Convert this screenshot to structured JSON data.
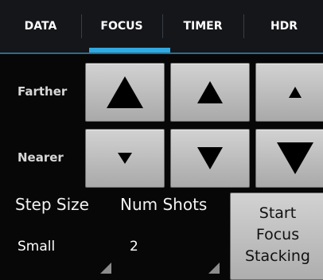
{
  "tabs": [
    {
      "label": "DATA",
      "selected": false
    },
    {
      "label": "FOCUS",
      "selected": true
    },
    {
      "label": "TIMER",
      "selected": false
    },
    {
      "label": "HDR",
      "selected": false
    }
  ],
  "colors": {
    "tab_indicator": "#31a9e0",
    "button_face": "#c4c4c4",
    "arrow": "#000000"
  },
  "focus": {
    "farther_label": "Farther",
    "nearer_label": "Nearer",
    "farther_buttons": [
      {
        "icon": "arrow-up-large-icon",
        "size": "large"
      },
      {
        "icon": "arrow-up-medium-icon",
        "size": "medium"
      },
      {
        "icon": "arrow-up-small-icon",
        "size": "small"
      }
    ],
    "nearer_buttons": [
      {
        "icon": "arrow-down-small-icon",
        "size": "small"
      },
      {
        "icon": "arrow-down-medium-icon",
        "size": "medium"
      },
      {
        "icon": "arrow-down-large-icon",
        "size": "large"
      }
    ]
  },
  "stacking": {
    "step_size_label": "Step Size",
    "num_shots_label": "Num Shots",
    "step_size_value": "Small",
    "num_shots_value": "2",
    "start_button": {
      "line1": "Start",
      "line2": "Focus",
      "line3": "Stacking"
    }
  }
}
